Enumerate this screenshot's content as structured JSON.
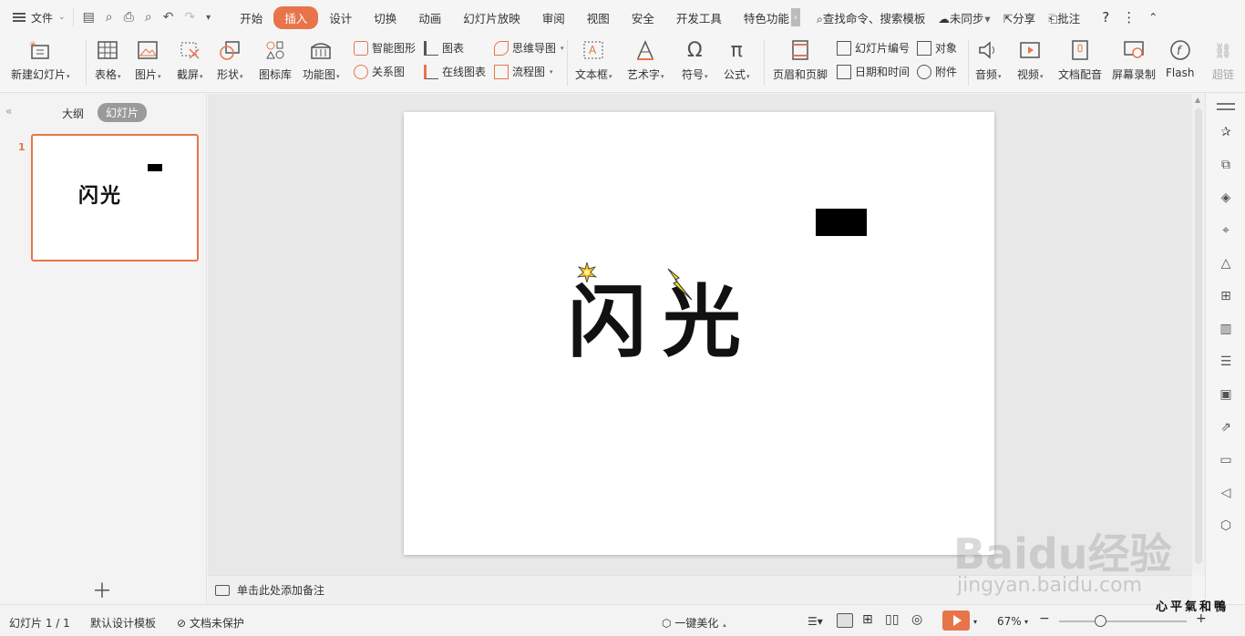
{
  "menubar": {
    "file_label": "文件",
    "tabs": [
      "开始",
      "插入",
      "设计",
      "切换",
      "动画",
      "幻灯片放映",
      "审阅",
      "视图",
      "安全",
      "开发工具",
      "特色功能"
    ],
    "active_tab": "插入",
    "search": "查找命令、搜索模板",
    "sync": "未同步",
    "share": "分享",
    "comment": "批注"
  },
  "ribbon": {
    "new_slide": "新建幻灯片",
    "table": "表格",
    "picture": "图片",
    "screenshot": "截屏",
    "shape": "形状",
    "icon_lib": "图标库",
    "func_chart": "功能图",
    "smart_art": "智能图形",
    "chart": "图表",
    "relation": "关系图",
    "online_chart": "在线图表",
    "mind_map": "思维导图",
    "flow_chart": "流程图",
    "text_box": "文本框",
    "word_art": "艺术字",
    "symbol": "符号",
    "formula": "公式",
    "header_footer": "页眉和页脚",
    "slide_number": "幻灯片编号",
    "object": "对象",
    "date_time": "日期和时间",
    "attachment": "附件",
    "audio": "音频",
    "video": "视频",
    "doc_voice": "文档配音",
    "screen_rec": "屏幕录制",
    "flash": "Flash",
    "hyperlink": "超链"
  },
  "leftpanel": {
    "outline_tab": "大纲",
    "slides_tab": "幻灯片",
    "slide_number": "1",
    "thumb_title": "闪光"
  },
  "slide": {
    "title": "闪光"
  },
  "notes": {
    "placeholder": "单击此处添加备注"
  },
  "statusbar": {
    "slide_info": "幻灯片 1 / 1",
    "template": "默认设计模板",
    "protect": "文档未保护",
    "beautify": "一键美化",
    "zoom": "67%"
  },
  "watermark": {
    "brand": "Baidu经验",
    "url": "jingyan.baidu.com",
    "author": "心平氣和鴨"
  },
  "colors": {
    "accent": "#e8744a",
    "bolt": "#f5e11a"
  }
}
